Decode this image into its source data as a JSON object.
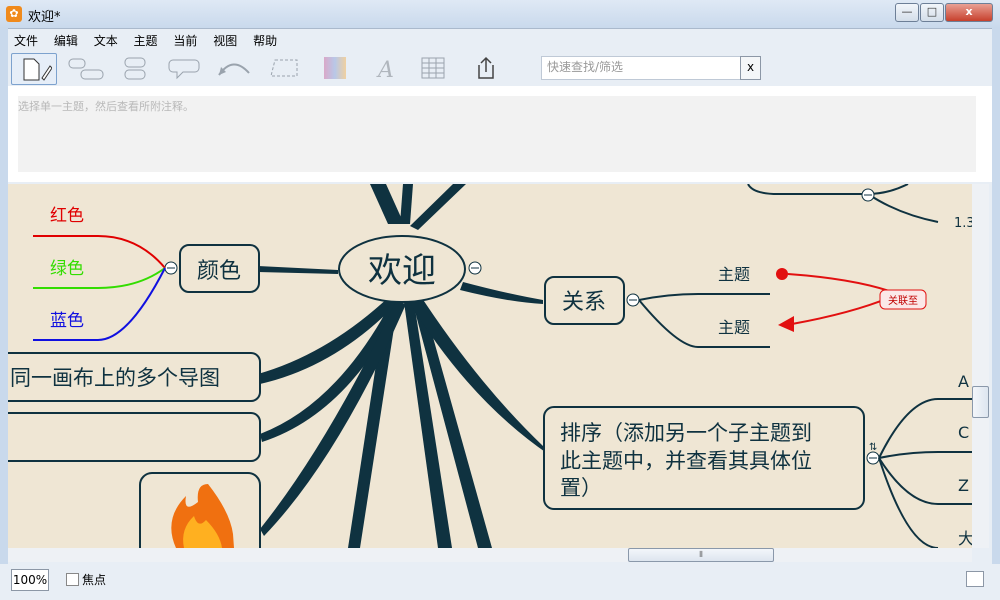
{
  "window": {
    "title": "欢迎*",
    "minimize": "—",
    "maximize": "□",
    "close": "x"
  },
  "menu": [
    "文件",
    "编辑",
    "文本",
    "主题",
    "当前",
    "视图",
    "帮助"
  ],
  "toolbar": {
    "icons": [
      "new-document-icon",
      "add-sibling-topic-icon",
      "add-subtopic-icon",
      "add-callout-icon",
      "add-relation-icon",
      "add-boundary-icon",
      "color-icon",
      "font-icon",
      "table-icon",
      "share-icon"
    ]
  },
  "search": {
    "placeholder": "快速查找/筛选",
    "clear_label": "x"
  },
  "notes": {
    "placeholder": "选择单一主题，然后查看所附注释。"
  },
  "mindmap": {
    "central": "欢迎",
    "colors_topic": "颜色",
    "color_children": [
      {
        "label": "红色",
        "color": "#e00000"
      },
      {
        "label": "绿色",
        "color": "#33dd00"
      },
      {
        "label": "蓝色",
        "color": "#1010e0"
      }
    ],
    "multi_map_topic": "同一画布上的多个导图",
    "relation_topic": "关系",
    "relation_children": [
      "主题",
      "主题"
    ],
    "relation_label": "关联至",
    "sort_topic": [
      "排序（添加另一个子主题到",
      "此主题中，并查看其具体位",
      "置）"
    ],
    "sort_children": [
      "A",
      "C",
      "Z",
      "大"
    ],
    "partial_label": "1.3",
    "line_color": "#0f3240",
    "relation_color": "#e21010"
  },
  "status": {
    "zoom": "100%",
    "focus_label": "焦点"
  }
}
